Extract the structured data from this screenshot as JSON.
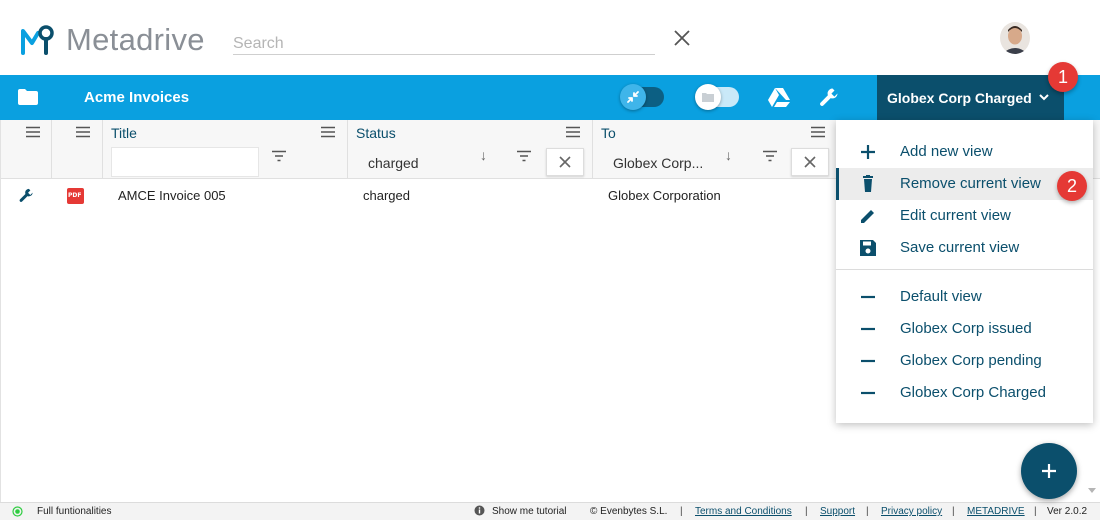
{
  "app": {
    "name": "Metadrive"
  },
  "header": {
    "search_placeholder": "Search",
    "search_value": ""
  },
  "toolbar": {
    "drive_title": "Acme Invoices",
    "current_view": "Globex Corp Charged"
  },
  "badges": {
    "first": "1",
    "second": "2"
  },
  "grid": {
    "columns": [
      {
        "label": "Title",
        "filter_value": ""
      },
      {
        "label": "Status",
        "filter_value": "charged"
      },
      {
        "label": "To",
        "filter_value": "Globex Corp..."
      }
    ],
    "rows": [
      {
        "title": "AMCE Invoice 005",
        "status": "charged",
        "to": "Globex Corporation",
        "file_type": "PDF"
      }
    ]
  },
  "view_menu": {
    "actions": [
      {
        "label": "Add new view",
        "icon": "plus-icon"
      },
      {
        "label": "Remove current view",
        "icon": "trash-icon"
      },
      {
        "label": "Edit current view",
        "icon": "pencil-icon"
      },
      {
        "label": "Save current view",
        "icon": "floppy-icon"
      }
    ],
    "views": [
      {
        "label": "Default view"
      },
      {
        "label": "Globex Corp issued"
      },
      {
        "label": "Globex Corp pending"
      },
      {
        "label": "Globex Corp Charged"
      }
    ]
  },
  "footer": {
    "status": "Full funtionalities",
    "tutorial": "Show me tutorial",
    "copyright": "© Evenbytes S.L.",
    "links": [
      "Terms and Conditions",
      "Support",
      "Privacy policy",
      "METADRIVE"
    ],
    "version": "Ver 2.0.2"
  },
  "colors": {
    "primary_blue": "#0aa0e0",
    "dark_navy": "#0b4f6c",
    "badge_red": "#e53935",
    "status_green": "#2ecc40"
  }
}
